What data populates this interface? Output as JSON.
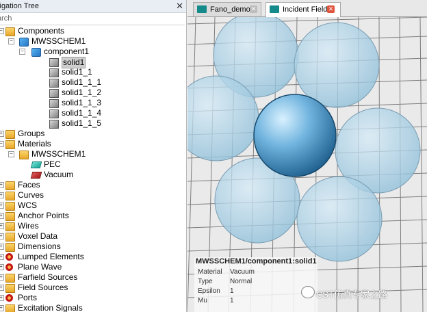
{
  "nav": {
    "title": "vigation Tree",
    "search_placeholder": "arch",
    "items": [
      {
        "label": "Components",
        "indent": 0,
        "icon": "folder-icon"
      },
      {
        "label": "MWSSCHEM1",
        "indent": 1,
        "icon": "component-icon"
      },
      {
        "label": "component1",
        "indent": 2,
        "icon": "component-icon"
      },
      {
        "label": "solid1",
        "indent": 3,
        "icon": "solid-cube-icon",
        "selected": true
      },
      {
        "label": "solid1_1",
        "indent": 3,
        "icon": "solid-cube-icon"
      },
      {
        "label": "solid1_1_1",
        "indent": 3,
        "icon": "solid-cube-icon"
      },
      {
        "label": "solid1_1_2",
        "indent": 3,
        "icon": "solid-cube-icon"
      },
      {
        "label": "solid1_1_3",
        "indent": 3,
        "icon": "solid-cube-icon"
      },
      {
        "label": "solid1_1_4",
        "indent": 3,
        "icon": "solid-cube-icon"
      },
      {
        "label": "solid1_1_5",
        "indent": 3,
        "icon": "solid-cube-icon"
      },
      {
        "label": "Groups",
        "indent": 0,
        "icon": "folder-icon"
      },
      {
        "label": "Materials",
        "indent": 0,
        "icon": "folder-icon"
      },
      {
        "label": "MWSSCHEM1",
        "indent": 1,
        "icon": "folder-icon"
      },
      {
        "label": "PEC",
        "indent": 2,
        "icon": "material-pec-icon"
      },
      {
        "label": "Vacuum",
        "indent": 2,
        "icon": "material-vacuum-icon"
      },
      {
        "label": "Faces",
        "indent": 0,
        "icon": "folder-icon"
      },
      {
        "label": "Curves",
        "indent": 0,
        "icon": "folder-icon"
      },
      {
        "label": "WCS",
        "indent": 0,
        "icon": "folder-icon"
      },
      {
        "label": "Anchor Points",
        "indent": 0,
        "icon": "folder-icon"
      },
      {
        "label": "Wires",
        "indent": 0,
        "icon": "folder-icon"
      },
      {
        "label": "Voxel Data",
        "indent": 0,
        "icon": "folder-icon"
      },
      {
        "label": "Dimensions",
        "indent": 0,
        "icon": "folder-icon"
      },
      {
        "label": "Lumped Elements",
        "indent": 0,
        "icon": "lumped-elements-icon"
      },
      {
        "label": "Plane Wave",
        "indent": 0,
        "icon": "plane-wave-icon"
      },
      {
        "label": "Farfield Sources",
        "indent": 0,
        "icon": "folder-icon"
      },
      {
        "label": "Field Sources",
        "indent": 0,
        "icon": "folder-icon"
      },
      {
        "label": "Ports",
        "indent": 0,
        "icon": "ports-icon"
      },
      {
        "label": "Excitation Signals",
        "indent": 0,
        "icon": "folder-icon"
      }
    ]
  },
  "tabs": [
    {
      "label": "Fano_demo",
      "active": false
    },
    {
      "label": "Incident Field",
      "active": true
    }
  ],
  "info": {
    "header": "MWSSCHEM1/component1:solid1",
    "rows": [
      {
        "key": "Material",
        "value": "Vacuum"
      },
      {
        "key": "Type",
        "value": "Normal"
      },
      {
        "key": "Epsilon",
        "value": "1"
      },
      {
        "key": "Mu",
        "value": "1"
      }
    ]
  },
  "watermark": "CST仿真专家之路",
  "colors": {
    "accent_tab": "#148a8a",
    "close_active": "#e0533c",
    "sphere": "#6fb3de"
  }
}
